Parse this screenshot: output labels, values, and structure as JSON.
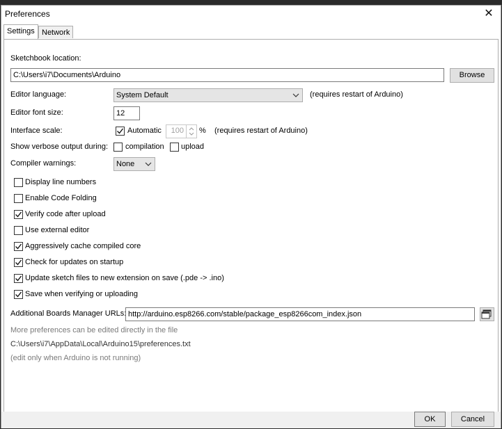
{
  "window": {
    "title": "Preferences"
  },
  "tabs": [
    {
      "label": "Settings"
    },
    {
      "label": "Network"
    }
  ],
  "sketchbook": {
    "label": "Sketchbook location:",
    "value": "C:\\Users\\i7\\Documents\\Arduino",
    "browse_label": "Browse"
  },
  "editor_language": {
    "label": "Editor language:",
    "value": "System Default",
    "note": "(requires restart of Arduino)"
  },
  "font_size": {
    "label": "Editor font size:",
    "value": "12"
  },
  "interface_scale": {
    "label": "Interface scale:",
    "automatic_label": "Automatic",
    "automatic_checked": true,
    "value": "100",
    "unit": "%",
    "note": "(requires restart of Arduino)"
  },
  "verbose": {
    "label": "Show verbose output during:",
    "compilation_label": "compilation",
    "compilation_checked": false,
    "upload_label": "upload",
    "upload_checked": false
  },
  "compiler_warnings": {
    "label": "Compiler warnings:",
    "value": "None"
  },
  "options": [
    {
      "label": "Display line numbers",
      "checked": false
    },
    {
      "label": "Enable Code Folding",
      "checked": false
    },
    {
      "label": "Verify code after upload",
      "checked": true
    },
    {
      "label": "Use external editor",
      "checked": false
    },
    {
      "label": "Aggressively cache compiled core",
      "checked": true
    },
    {
      "label": "Check for updates on startup",
      "checked": true
    },
    {
      "label": "Update sketch files to new extension on save (.pde -> .ino)",
      "checked": true
    },
    {
      "label": "Save when verifying or uploading",
      "checked": true
    }
  ],
  "boards_manager": {
    "label": "Additional Boards Manager URLs:",
    "value": "http://arduino.esp8266.com/stable/package_esp8266com_index.json"
  },
  "info": {
    "line1": "More preferences can be edited directly in the file",
    "path": "C:\\Users\\i7\\AppData\\Local\\Arduino15\\preferences.txt",
    "line3": "(edit only when Arduino is not running)"
  },
  "buttons": {
    "ok": "OK",
    "cancel": "Cancel"
  }
}
